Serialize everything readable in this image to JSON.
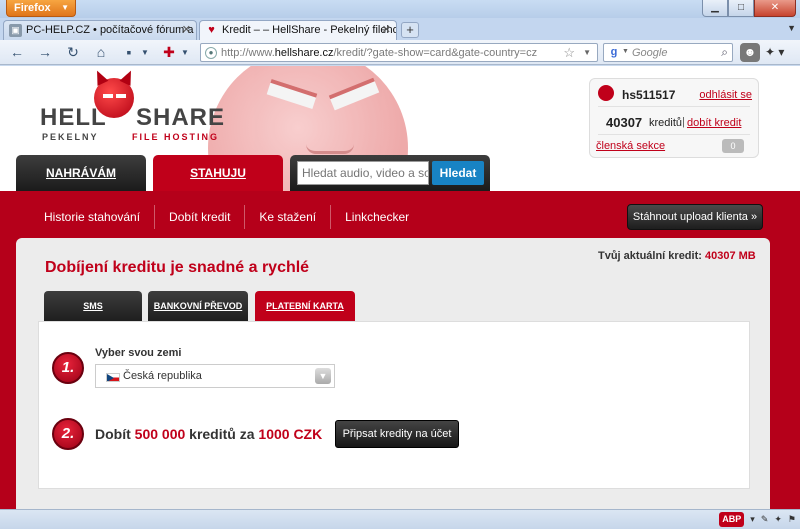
{
  "browser": {
    "menu_label": "Firefox",
    "tabs": [
      {
        "title": "PC-HELP.CZ • počítačové fórum a pc..."
      },
      {
        "title": "Kredit – – HellShare - Pekelný filehosti..."
      }
    ],
    "url_prefix": "http://www.",
    "url_host": "hellshare.cz",
    "url_rest": "/kredit/?gate-show=card&gate-country=cz",
    "search_placeholder": "Google"
  },
  "logo": {
    "word_left": "HELL",
    "word_right": "SHARE",
    "tag_left": "PEKELNY",
    "tag_right": "FILE HOSTING"
  },
  "user": {
    "name": "hs511517",
    "logout": "odhlásit se",
    "credits": "40307",
    "credits_label": "kreditů",
    "separator": "|",
    "buy_credit": "dobít kredit",
    "member_section": "členská sekce",
    "messages": "0"
  },
  "main_tabs": {
    "upload": "NAHRÁVÁM",
    "download": "STAHUJU"
  },
  "search": {
    "placeholder": "Hledat audio, video a software",
    "button": "Hledat"
  },
  "subnav": {
    "items": [
      "Historie stahování",
      "Dobít kredit",
      "Ke stažení",
      "Linkchecker"
    ],
    "client_button": "Stáhnout upload klienta »"
  },
  "content": {
    "heading": "Dobíjení kreditu je snadné a rychlé",
    "current_credit_label": "Tvůj aktuální kredit:",
    "current_credit_value": "40307 MB",
    "payment_tabs": [
      "SMS",
      "BANKOVNÍ PŘEVOD",
      "PLATEBNÍ KARTA"
    ],
    "active_payment_tab": "PLATEBNÍ KARTA",
    "step1": {
      "number": "1.",
      "label": "Vyber svou zemi",
      "country": "Česká republika"
    },
    "step2": {
      "number": "2.",
      "text_a": "Dobít",
      "amount": "500 000",
      "text_b": "kreditů za",
      "price": "1000 CZK",
      "button": "Připsat kredity na účet"
    }
  },
  "colors": {
    "brand_red": "#c0001a",
    "band_red": "#b5001a",
    "search_blue": "#1883c4"
  }
}
